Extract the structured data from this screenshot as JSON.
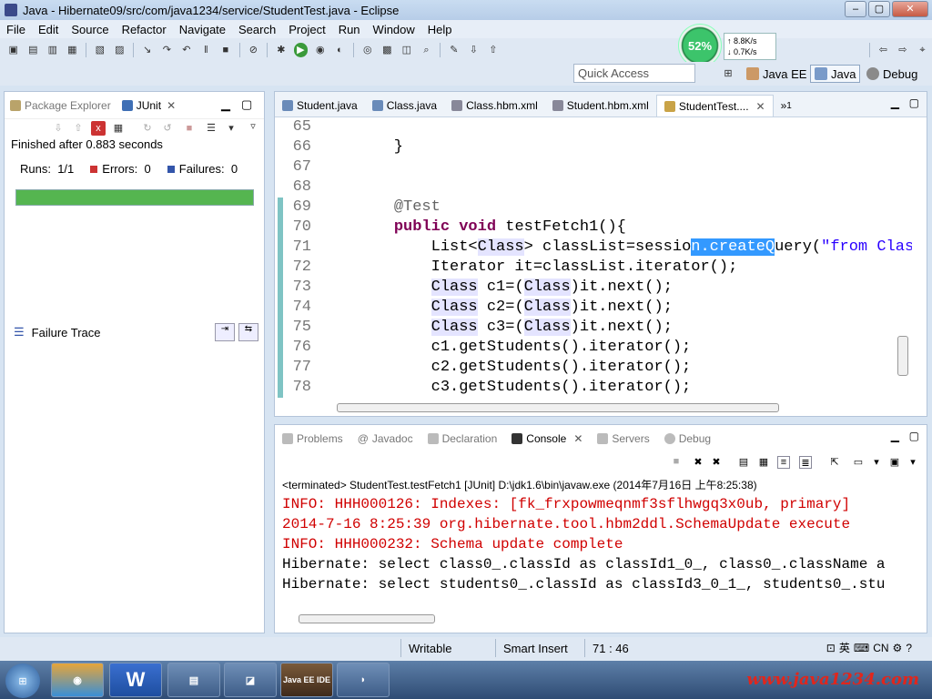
{
  "window": {
    "title": "Java - Hibernate09/src/com/java1234/service/StudentTest.java - Eclipse",
    "controls": [
      "–",
      "▢",
      "✕"
    ]
  },
  "menu": [
    "File",
    "Edit",
    "Source",
    "Refactor",
    "Navigate",
    "Search",
    "Project",
    "Run",
    "Window",
    "Help"
  ],
  "monitor": {
    "percent": "52%",
    "up": "8.8K/s",
    "down": "0.7K/s"
  },
  "perspectives": {
    "quick_access_placeholder": "Quick Access",
    "items": [
      "Java EE",
      "Java",
      "Debug"
    ],
    "active": "Java"
  },
  "left_panel": {
    "tabs": [
      "Package Explorer",
      "JUnit"
    ],
    "active_tab": "JUnit",
    "finished_text": "Finished after 0.883 seconds",
    "runs_label": "Runs:",
    "runs_value": "1/1",
    "errors_label": "Errors:",
    "errors_value": "0",
    "failures_label": "Failures:",
    "failures_value": "0",
    "progress_fraction": 1.0,
    "progress_color": "#55b550",
    "failure_trace_label": "Failure Trace"
  },
  "editor": {
    "tabs": [
      "Student.java",
      "Class.java",
      "Class.hbm.xml",
      "Student.hbm.xml",
      "StudentTest...."
    ],
    "active_tab": "StudentTest....",
    "overflow_count": "1",
    "lines": [
      {
        "num": "65",
        "text": ""
      },
      {
        "num": "66",
        "text": "    }"
      },
      {
        "num": "67",
        "text": ""
      },
      {
        "num": "68",
        "text": ""
      },
      {
        "num": "69",
        "text": "    @Test"
      },
      {
        "num": "70",
        "text": "    public void testFetch1(){"
      },
      {
        "num": "71",
        "text": "        List<Class> classList=session.createQuery(\"from Class\")"
      },
      {
        "num": "72",
        "text": "        Iterator it=classList.iterator();"
      },
      {
        "num": "73",
        "text": "        Class c1=(Class)it.next();"
      },
      {
        "num": "74",
        "text": "        Class c2=(Class)it.next();"
      },
      {
        "num": "75",
        "text": "        Class c3=(Class)it.next();"
      },
      {
        "num": "76",
        "text": "        c1.getStudents().iterator();"
      },
      {
        "num": "77",
        "text": "        c2.getStudents().iterator();"
      },
      {
        "num": "78",
        "text": "        c3.getStudents().iterator();"
      }
    ]
  },
  "console": {
    "tabs": [
      "Problems",
      "Javadoc",
      "Declaration",
      "Console",
      "Servers",
      "Debug"
    ],
    "active_tab": "Console",
    "terminated": "<terminated> StudentTest.testFetch1 [JUnit] D:\\jdk1.6\\bin\\javaw.exe (2014年7月16日 上午8:25:38)",
    "lines": [
      {
        "text": "INFO: HHH000126: Indexes: [fk_frxpowmeqnmf3sflhwgq3x0ub, primary]",
        "color": "#d00000"
      },
      {
        "text": "2014-7-16 8:25:39 org.hibernate.tool.hbm2ddl.SchemaUpdate execute",
        "color": "#d00000"
      },
      {
        "text": "INFO: HHH000232: Schema update complete",
        "color": "#d00000"
      },
      {
        "text": "Hibernate: select class0_.classId as classId1_0_, class0_.className a",
        "color": "#000000"
      },
      {
        "text": "Hibernate: select students0_.classId as classId3_0_1_, students0_.stu",
        "color": "#000000"
      }
    ]
  },
  "status": {
    "writable": "Writable",
    "insert_mode": "Smart Insert",
    "position": "71 : 46",
    "ime": [
      "英",
      "CN"
    ]
  },
  "taskbar": {
    "tasks": [
      "W",
      "Java EE IDE"
    ],
    "watermark": "www.java1234.com"
  }
}
